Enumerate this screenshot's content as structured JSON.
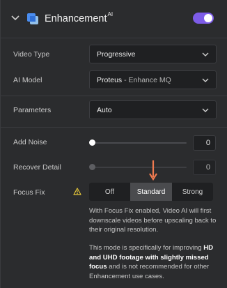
{
  "header": {
    "title": "Enhancement",
    "title_sup": "AI",
    "toggle_on": true
  },
  "video_type": {
    "label": "Video Type",
    "value": "Progressive"
  },
  "ai_model": {
    "label": "AI Model",
    "value_main": "Proteus",
    "value_sub": " - Enhance MQ"
  },
  "parameters": {
    "label": "Parameters",
    "value": "Auto"
  },
  "add_noise": {
    "label": "Add Noise",
    "value": "0"
  },
  "recover_detail": {
    "label": "Recover Detail",
    "value": "0"
  },
  "focus_fix": {
    "label": "Focus Fix",
    "options": [
      "Off",
      "Standard",
      "Strong"
    ],
    "selected": "Standard"
  },
  "description": {
    "p1": "With Focus Fix enabled, Video AI will first downscale videos before upscaling back to their original resolution.",
    "p2_a": "This mode is specifically for improving ",
    "p2_b": "HD and UHD footage with slightly missed focus",
    "p2_c": " and is not recommended for other Enhancement use cases."
  },
  "colors": {
    "accent": "#7d5ce8",
    "arrow": "#f07a50",
    "warning": "#e8c93a"
  }
}
